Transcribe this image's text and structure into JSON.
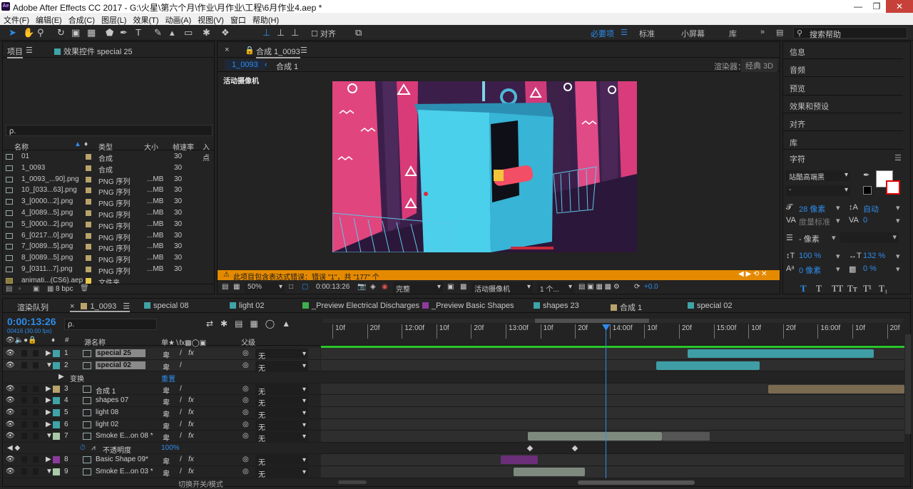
{
  "window": {
    "title": "Adobe After Effects CC 2017 - G:\\火星\\第六个月\\作业\\月作业\\工程\\6月作业4.aep *",
    "app_icon": "Ae"
  },
  "menu": [
    "文件(F)",
    "编辑(E)",
    "合成(C)",
    "图层(L)",
    "效果(T)",
    "动画(A)",
    "视图(V)",
    "窗口",
    "帮助(H)"
  ],
  "toolbar": {
    "align_label": "对齐",
    "workspaces": [
      "必要项",
      "标准",
      "小屏幕",
      "库"
    ],
    "search_placeholder": "搜索帮助"
  },
  "project_panel": {
    "tab_project": "项目",
    "tab_effects": "效果控件 special 25",
    "search_placeholder": "ρ.",
    "columns": [
      "名称",
      "类型",
      "大小",
      "帧速率",
      "入点"
    ],
    "items": [
      {
        "name": "01",
        "type": "合成",
        "size": "",
        "fps": "30",
        "color": "#b9a36b",
        "comp": true
      },
      {
        "name": "1_0093",
        "type": "合成",
        "size": "",
        "fps": "30",
        "color": "#b9a36b",
        "comp": true
      },
      {
        "name": "1_0093_...90].png",
        "type": "PNG 序列",
        "size": "...MB",
        "fps": "30",
        "color": "#b9a36b",
        "comp": false
      },
      {
        "name": "10_[033...63].png",
        "type": "PNG 序列",
        "size": "...MB",
        "fps": "30",
        "color": "#b9a36b",
        "comp": false
      },
      {
        "name": "3_[0000...2].png",
        "type": "PNG 序列",
        "size": "...MB",
        "fps": "30",
        "color": "#b9a36b",
        "comp": false
      },
      {
        "name": "4_[0089...5].png",
        "type": "PNG 序列",
        "size": "...MB",
        "fps": "30",
        "color": "#b9a36b",
        "comp": false
      },
      {
        "name": "5_[0000...2].png",
        "type": "PNG 序列",
        "size": "...MB",
        "fps": "30",
        "color": "#b9a36b",
        "comp": false
      },
      {
        "name": "6_[0217...0].png",
        "type": "PNG 序列",
        "size": "...MB",
        "fps": "30",
        "color": "#b9a36b",
        "comp": false
      },
      {
        "name": "7_[0089...5].png",
        "type": "PNG 序列",
        "size": "...MB",
        "fps": "30",
        "color": "#b9a36b",
        "comp": false
      },
      {
        "name": "8_[0089...5].png",
        "type": "PNG 序列",
        "size": "...MB",
        "fps": "30",
        "color": "#b9a36b",
        "comp": false
      },
      {
        "name": "9_[0311...7].png",
        "type": "PNG 序列",
        "size": "...MB",
        "fps": "30",
        "color": "#b9a36b",
        "comp": false
      },
      {
        "name": "animati...(CS6).aep",
        "type": "文件夹",
        "size": "",
        "fps": "",
        "color": "#e6c84a",
        "comp": false
      }
    ],
    "bpc": "8 bpc"
  },
  "comp_panel": {
    "tab": "合成 1_0093",
    "breadcrumbs": [
      "1_0093",
      "合成 1"
    ],
    "renderer_label": "渲染器：",
    "renderer_value": "经典 3D",
    "camera_label": "活动摄像机",
    "warning": "此项目包含表达式错误：错误 \"1\"，共 \"177\" 个",
    "zoom": "50%",
    "timecode": "0:00:13:26",
    "quality": "完整",
    "view_camera": "活动摄像机",
    "views": "1 个...",
    "exposure": "+0.0"
  },
  "right_panels": [
    "信息",
    "音频",
    "预览",
    "效果和预设",
    "对齐",
    "库"
  ],
  "character_panel": {
    "title": "字符",
    "font": "站酷高端黑",
    "style": "-",
    "size": "28 像素",
    "leading": "自动",
    "kerning": "度量标准",
    "tracking": "0",
    "stroke": "- 像素",
    "vscale": "100 %",
    "hscale": "132 %",
    "baseline": "0 像素",
    "tsume": "0 %",
    "styles": [
      "T",
      "T",
      "TT",
      "Tт",
      "T¹",
      "T₁"
    ]
  },
  "timeline": {
    "tabs": [
      {
        "label": "渲染队列",
        "color": ""
      },
      {
        "label": "1_0093",
        "color": "#b9a36b"
      },
      {
        "label": "special 08",
        "color": "#3fa3a8"
      },
      {
        "label": "light 02",
        "color": "#3fa3a8"
      },
      {
        "label": "_Preview Electrical Discharges",
        "color": "#3fb04f"
      },
      {
        "label": "_Preview Basic Shapes",
        "color": "#8c3a9c"
      },
      {
        "label": "shapes 23",
        "color": "#3fa3a8"
      },
      {
        "label": "合成 1",
        "color": "#b9a36b"
      },
      {
        "label": "special 02",
        "color": "#3fa3a8"
      }
    ],
    "timecode": "0:00:13:26",
    "frame_info": "00416 (30.00 fps)",
    "search_placeholder": "ρ.",
    "header_source": "源名称",
    "header_parent": "父级",
    "ruler": [
      "10f",
      "20f",
      "12:00f",
      "10f",
      "20f",
      "13:00f",
      "10f",
      "20f",
      "14:00f",
      "10f",
      "20f",
      "15:00f",
      "10f",
      "20f",
      "16:00f",
      "10f",
      "20f"
    ],
    "layers": [
      {
        "num": "1",
        "name": "special 25",
        "color": "#3fa3a8",
        "fx": true,
        "parent": "无",
        "bar": {
          "start": 0.628,
          "end": 0.948,
          "color": "#3f9ea5"
        }
      },
      {
        "num": "2",
        "name": "special 02",
        "color": "#3fa3a8",
        "fx": false,
        "parent": "无",
        "bar": {
          "start": 0.574,
          "end": 0.752,
          "color": "#3f9ea5"
        }
      },
      {
        "num": "",
        "name": "变换",
        "sub": true,
        "value": "重置"
      },
      {
        "num": "3",
        "name": "合成 1",
        "color": "#b9a36b",
        "fx": false,
        "parent": "无",
        "bar": {
          "start": 0.766,
          "end": 1.0,
          "color": "#7a6a50"
        }
      },
      {
        "num": "4",
        "name": "shapes 07",
        "color": "#3fa3a8",
        "fx": true,
        "parent": "无"
      },
      {
        "num": "5",
        "name": "light 08",
        "color": "#3fa3a8",
        "fx": true,
        "parent": "无"
      },
      {
        "num": "6",
        "name": "light 02",
        "color": "#3fa3a8",
        "fx": true,
        "parent": "无"
      },
      {
        "num": "7",
        "name": "Smoke E...on 08 *",
        "color": "#a8c9a8",
        "fx": true,
        "parent": "无",
        "bar": {
          "start": 0.355,
          "end": 0.584,
          "color": "#7e8a7e"
        }
      },
      {
        "num": "",
        "name": "不透明度",
        "sub": true,
        "value": "100%"
      },
      {
        "num": "8",
        "name": "Basic Shape 09*",
        "color": "#8c3a9c",
        "fx": true,
        "parent": "无",
        "bar": {
          "start": 0.308,
          "end": 0.372,
          "color": "#6a2f78"
        }
      },
      {
        "num": "9",
        "name": "Smoke E...on 03 *",
        "color": "#a8c9a8",
        "fx": true,
        "parent": "无",
        "bar": {
          "start": 0.33,
          "end": 0.452,
          "color": "#7e8a7e"
        }
      }
    ],
    "footer": "切换开关/模式",
    "playhead": 0.488
  }
}
